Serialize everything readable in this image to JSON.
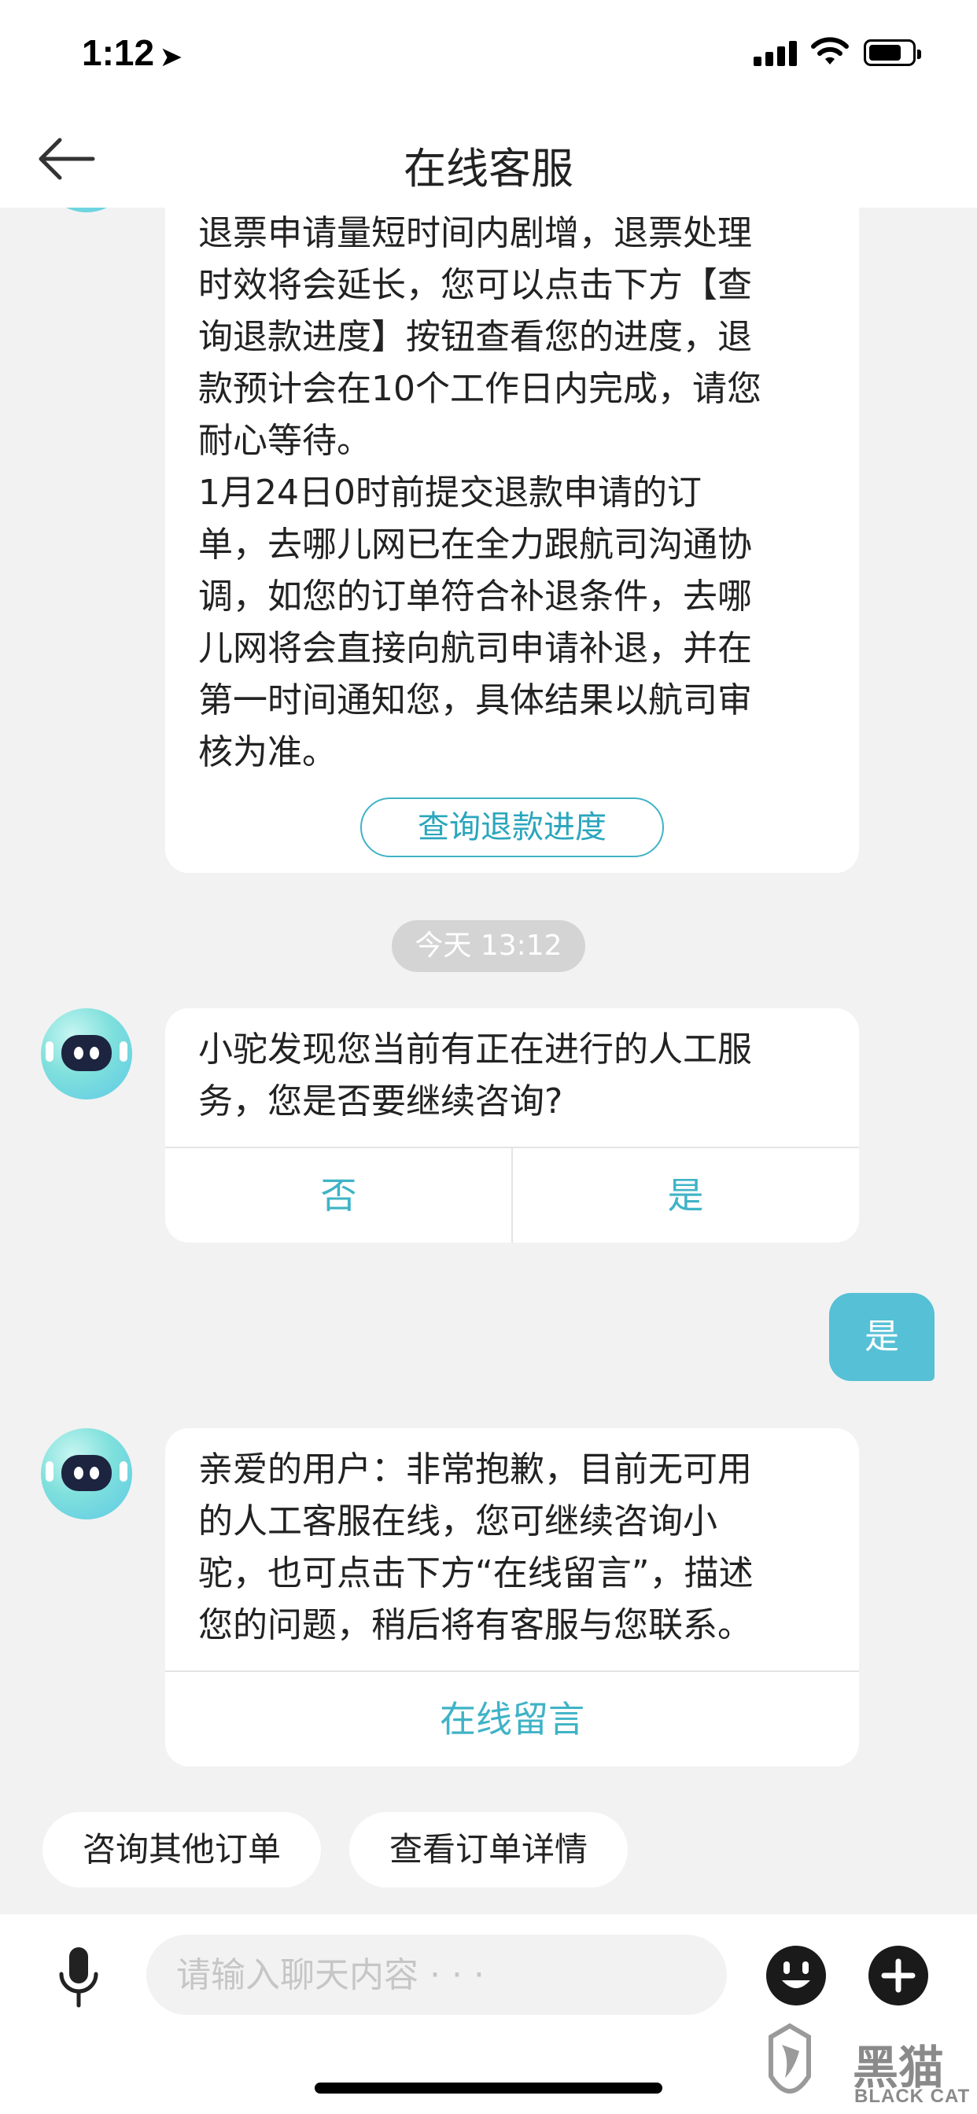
{
  "status_bar": {
    "time": "1:12",
    "location_arrow": "location-arrow-icon",
    "signal_icon": "cellular-signal-icon",
    "wifi_icon": "wifi-icon",
    "battery_icon": "battery-icon"
  },
  "nav": {
    "back_icon": "back-arrow-icon",
    "title": "在线客服"
  },
  "messages": {
    "refund_notice": {
      "lines": [
        "退票申请量短时间内剧增，退票处理",
        "时效将会延长，您可以点击下方【查",
        "询退款进度】按钮查看您的进度，退",
        "款预计会在10个工作日内完成，请您",
        "耐心等待。",
        "1月24日0时前提交退款申请的订",
        "单，去哪儿网已在全力跟航司沟通协",
        "调，如您的订单符合补退条件，去哪",
        "儿网将会直接向航司申请补退，并在",
        "第一时间通知您，具体结果以航司审",
        "核为准。"
      ],
      "button_label": "查询退款进度"
    },
    "timestamp": "今天 13:12",
    "continue_prompt": {
      "lines": [
        "小驼发现您当前有正在进行的人工服",
        "务，您是否要继续咨询?"
      ],
      "no_label": "否",
      "yes_label": "是"
    },
    "user_reply": "是",
    "no_agent_notice": {
      "lines": [
        "亲爱的用户：非常抱歉，目前无可用",
        "的人工客服在线，您可继续咨询小",
        "驼，也可点击下方“在线留言”，描述",
        "您的问题，稍后将有客服与您联系。"
      ],
      "button_label": "在线留言"
    }
  },
  "quick_actions": [
    {
      "label": "咨询其他订单"
    },
    {
      "label": "查看订单详情"
    }
  ],
  "input_bar": {
    "placeholder": "请输入聊天内容 · · ·",
    "mic_icon": "microphone-icon",
    "emoji_icon": "emoji-icon",
    "plus_icon": "plus-icon"
  },
  "watermark": {
    "text": "黑猫",
    "sub": "BLACK CAT"
  },
  "colors": {
    "accent": "#3fb3c6",
    "user_bubble": "#55c0d6",
    "background": "#f2f2f2"
  }
}
